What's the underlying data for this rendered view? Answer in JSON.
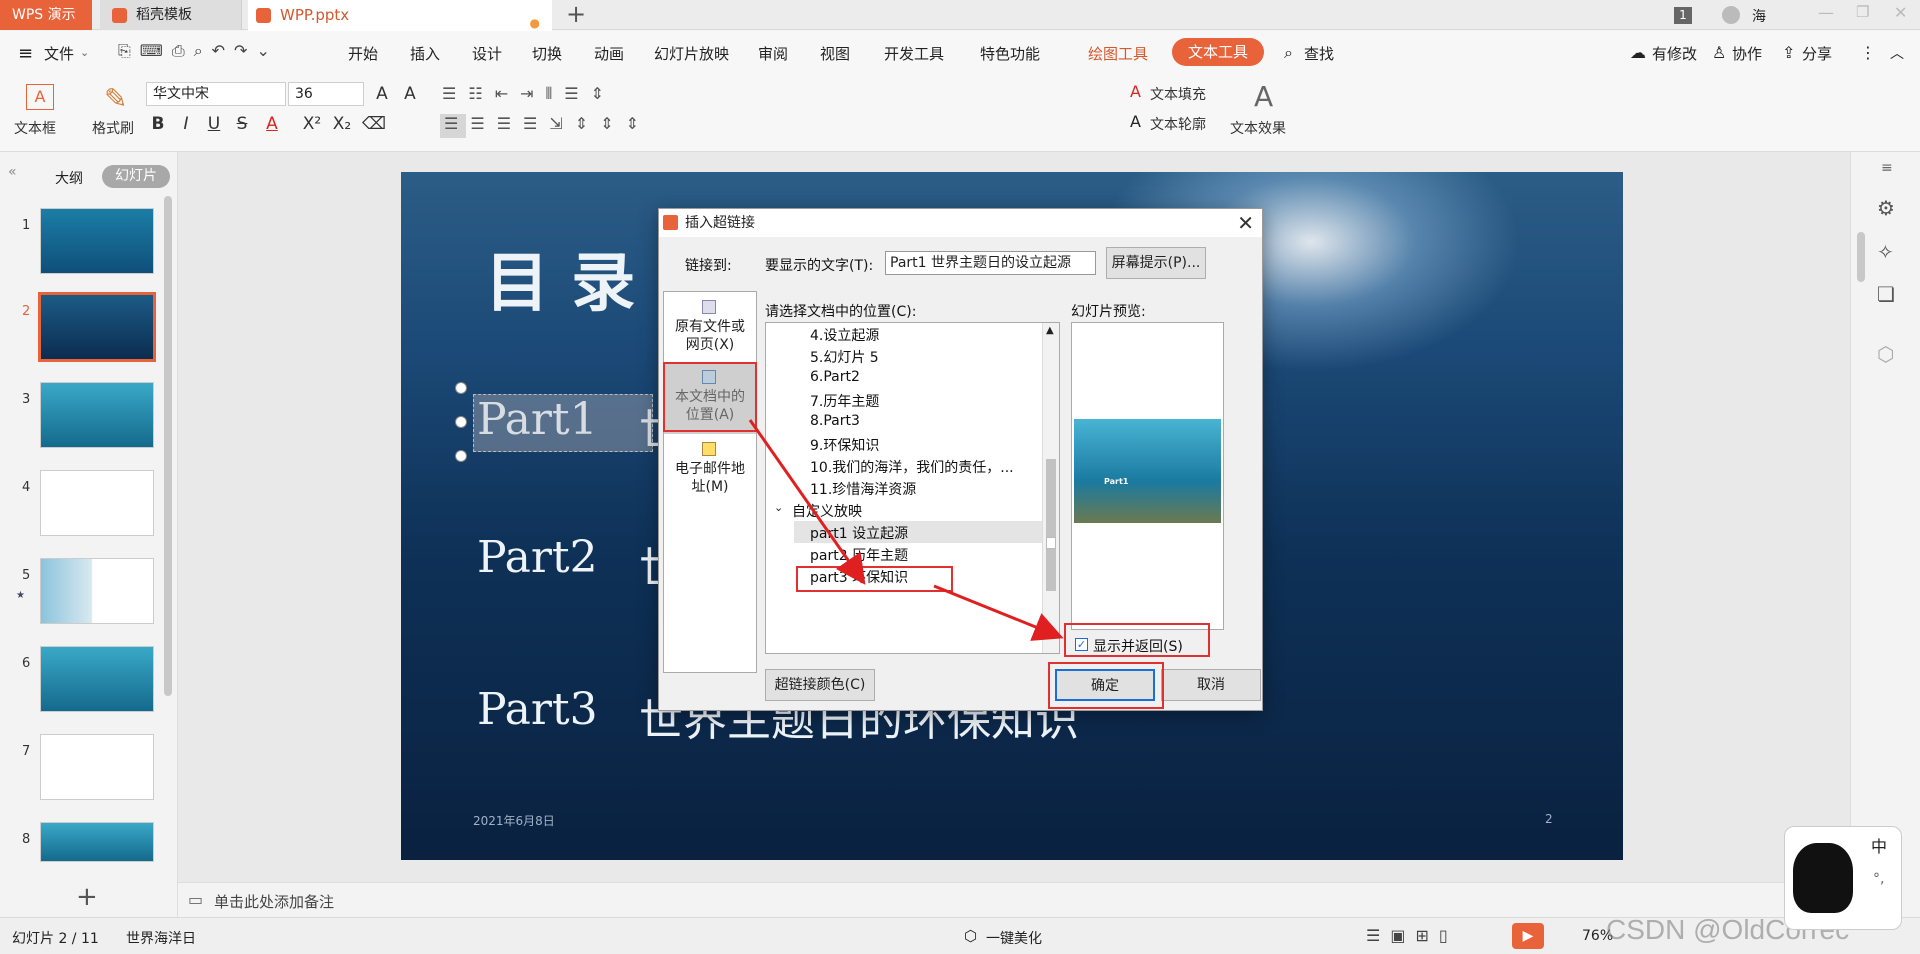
{
  "tabs": {
    "wps": "WPS 演示",
    "daoke": "稻壳模板",
    "file": "WPP.pptx",
    "add": "+"
  },
  "window": {
    "badge": "1",
    "user": "海"
  },
  "menu": {
    "file": "文件",
    "items": [
      "开始",
      "插入",
      "设计",
      "切换",
      "动画",
      "幻灯片放映",
      "审阅",
      "视图",
      "开发工具",
      "特色功能"
    ],
    "drawing_tool": "绘图工具",
    "text_tool": "文本工具",
    "search": "查找",
    "modified": "有修改",
    "collab": "协作",
    "share": "分享"
  },
  "ribbon": {
    "textbox": "文本框",
    "format_painter": "格式刷",
    "font": "华文中宋",
    "size": "36",
    "wordart_letter": "A",
    "text_fill": "文本填充",
    "text_outline": "文本轮廓",
    "text_effect": "文本效果"
  },
  "left_panel": {
    "tab_outline": "大纲",
    "tab_slides": "幻灯片",
    "slides": [
      "1",
      "2",
      "3",
      "4",
      "5",
      "6",
      "7",
      "8"
    ],
    "current": "2",
    "add": "+"
  },
  "slide": {
    "title": "目 录",
    "part1_a": "Part1",
    "part1_b": "世",
    "part2_a": "Part2",
    "part2_b": "世",
    "part3_a": "Part3",
    "part3_b": "世界主题日的环保知识",
    "date": "2021年6月8日",
    "page": "2"
  },
  "dialog": {
    "title": "插入超链接",
    "link_to": "链接到:",
    "display_label": "要显示的文字(T):",
    "display_value": "Part1   世界主题日的设立起源",
    "screen_tip": "屏幕提示(P)...",
    "loc_label": "请选择文档中的位置(C):",
    "preview_label": "幻灯片预览:",
    "link_options": [
      "原有文件或网页(X)",
      "本文档中的位置(A)",
      "电子邮件地址(M)"
    ],
    "locations": [
      "4.设立起源",
      "5.幻灯片 5",
      "6.Part2",
      "7.历年主题",
      "8.Part3",
      "9.环保知识",
      "10.我们的海洋，我们的责任，...",
      "11.珍惜海洋资源"
    ],
    "custom_group": "自定义放映",
    "custom_items": [
      "part1 设立起源",
      "part2 历年主题",
      "part3 环保知识"
    ],
    "show_return": "显示并返回(S)",
    "link_color": "超链接颜色(C)",
    "ok": "确定",
    "cancel": "取消",
    "preview_text": "Part1"
  },
  "notes": "单击此处添加备注",
  "status": {
    "slide_count": "幻灯片 2 / 11",
    "theme": "世界海洋日",
    "beautify": "一键美化",
    "zoom": "76%",
    "watermark": "CSDN @OldCorrec"
  },
  "ime": {
    "lang": "中"
  },
  "colors": {
    "accent": "#e8623a",
    "highlight": "#e03030",
    "link_blue": "#0a5bd3"
  }
}
